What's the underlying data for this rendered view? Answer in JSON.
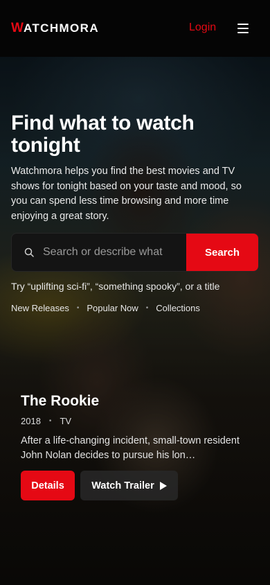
{
  "header": {
    "logo_mark": "W",
    "logo_text": "ATCHMORA",
    "login_label": "Login"
  },
  "hero": {
    "title": "Find what to watch tonight",
    "description": "Watchmora helps you find the best movies and TV shows for tonight based on your taste and mood, so you can spend less time browsing and more time enjoying a great story.",
    "search": {
      "placeholder": "Search or describe what",
      "button_label": "Search"
    },
    "hint": "Try “uplifting sci-fi”, “something spooky”, or a title",
    "quick_links": [
      "New Releases",
      "Popular Now",
      "Collections"
    ]
  },
  "featured": {
    "title": "The Rookie",
    "year": "2018",
    "type": "TV",
    "description": "After a life-changing incident, small-town resident John Nolan decides to pursue his lon…",
    "details_label": "Details",
    "trailer_label": "Watch Trailer"
  },
  "colors": {
    "accent": "#e50914",
    "background": "#000000"
  },
  "icons": {
    "menu": "hamburger-menu-icon",
    "search": "search-icon",
    "play": "play-icon"
  }
}
